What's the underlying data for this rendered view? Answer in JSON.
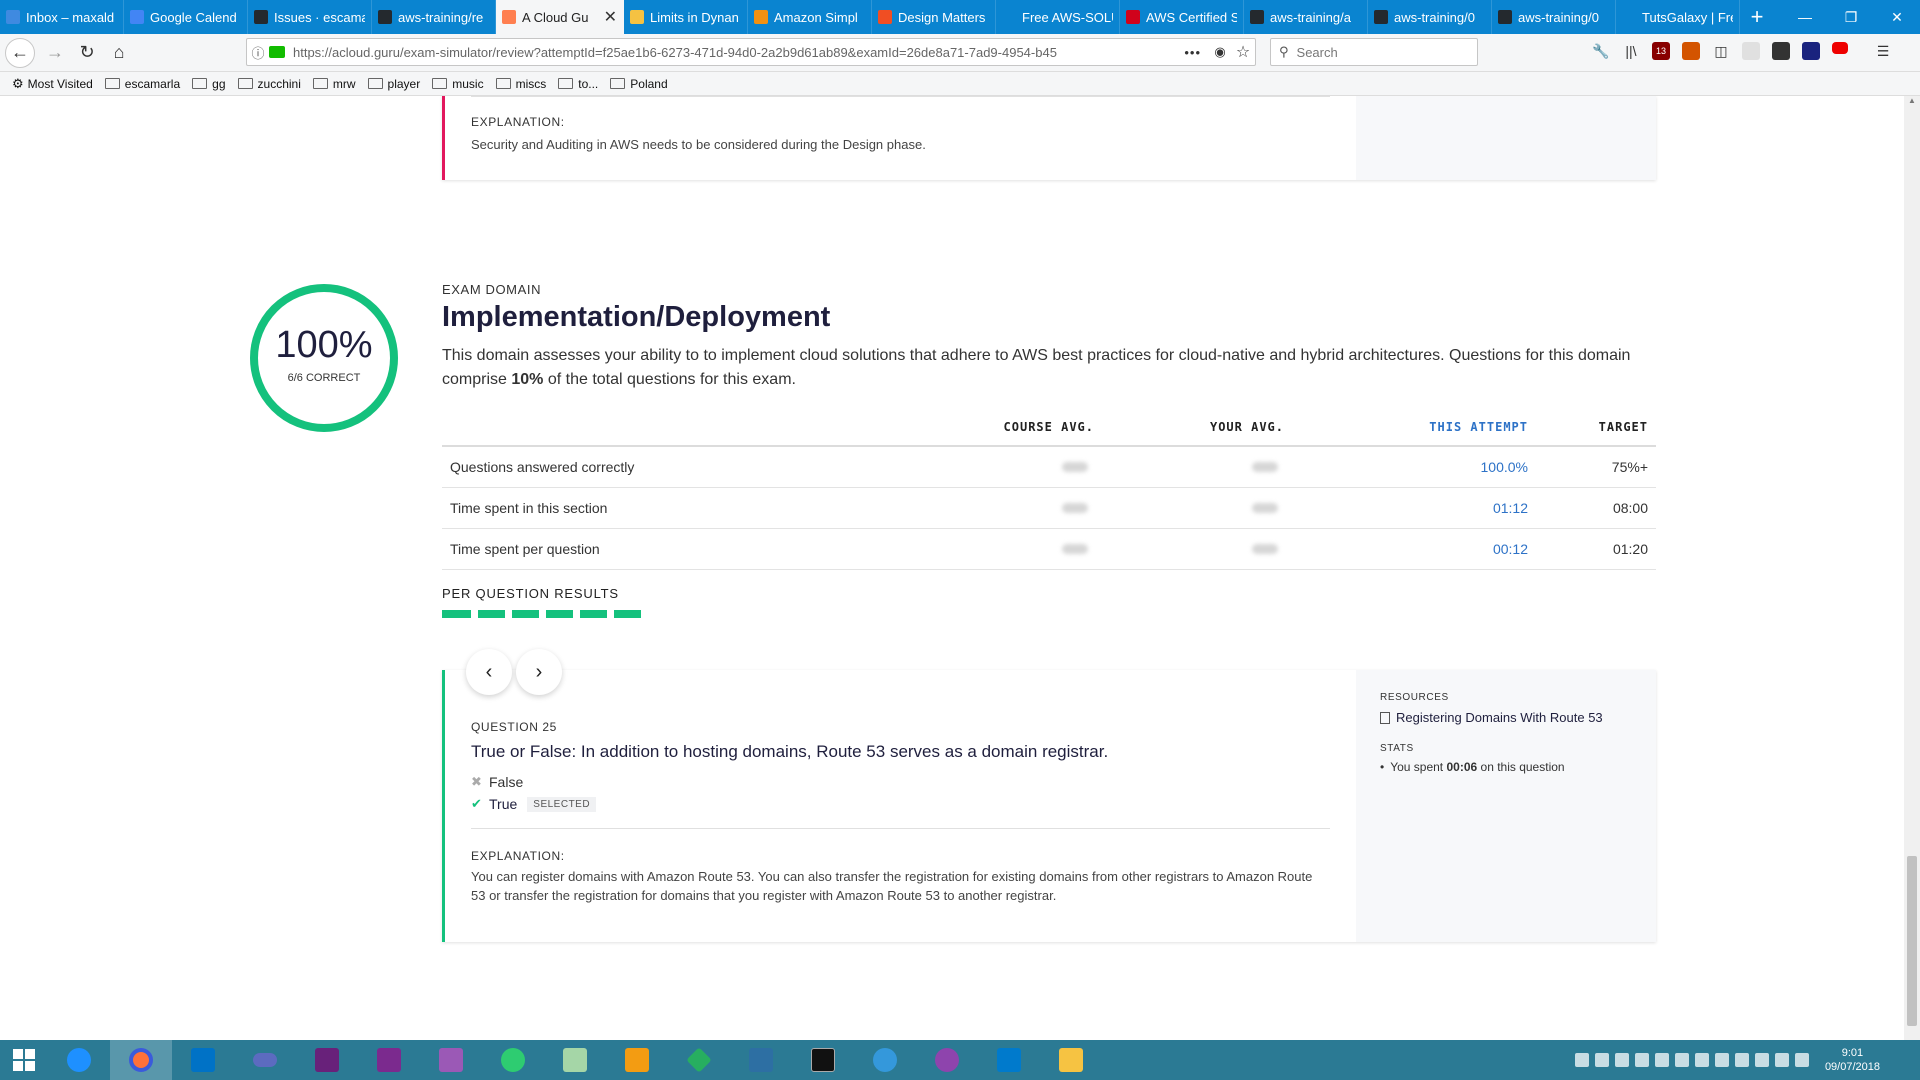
{
  "browser": {
    "tabs": [
      {
        "label": "Inbox – maxald",
        "color": "#3f8ae0"
      },
      {
        "label": "Google Calend",
        "color": "#4285f4"
      },
      {
        "label": "Issues · escama",
        "color": "#24292e"
      },
      {
        "label": "aws-training/re",
        "color": "#24292e"
      },
      {
        "label": "A Cloud Gu",
        "color": "#ff7f50",
        "active": true
      },
      {
        "label": "Limits in Dynan",
        "color": "#f5c242"
      },
      {
        "label": "Amazon Simpl",
        "color": "#f29111"
      },
      {
        "label": "Design Matters",
        "color": "#f04e23"
      },
      {
        "label": "Free AWS-SOLUTIO",
        "color": "#0a84d0"
      },
      {
        "label": "AWS Certified S",
        "color": "#d0021b"
      },
      {
        "label": "aws-training/a",
        "color": "#24292e"
      },
      {
        "label": "aws-training/0",
        "color": "#24292e"
      },
      {
        "label": "aws-training/0",
        "color": "#24292e"
      },
      {
        "label": "TutsGalaxy | Free C",
        "color": "#0a84d0"
      }
    ],
    "url": "https://acloud.guru/exam-simulator/review?attemptId=f25ae1b6-6273-471d-94d0-2a2b9d61ab89&examId=26de8a71-7ad9-4954-b45",
    "url_host": "acloud.guru",
    "search_placeholder": "Search",
    "bookmarks": [
      {
        "label": "Most Visited",
        "type": "gear"
      },
      {
        "label": "escamarla",
        "type": "folder"
      },
      {
        "label": "gg",
        "type": "folder"
      },
      {
        "label": "zucchini",
        "type": "folder"
      },
      {
        "label": "mrw",
        "type": "folder"
      },
      {
        "label": "player",
        "type": "folder"
      },
      {
        "label": "music",
        "type": "folder"
      },
      {
        "label": "miscs",
        "type": "folder"
      },
      {
        "label": "to...",
        "type": "folder"
      },
      {
        "label": "Poland",
        "type": "folder"
      }
    ],
    "notification_badge": "13"
  },
  "prev_card": {
    "explanation_label": "EXPLANATION:",
    "explanation_text": "Security and Auditing in AWS needs to be considered during the Design phase.",
    "accent": "#e2175d"
  },
  "domain": {
    "eyebrow": "EXAM DOMAIN",
    "title": "Implementation/Deployment",
    "desc_before": "This domain assesses your ability to to implement cloud solutions that adhere to AWS best practices for cloud-native and hybrid architectures. Questions for this domain comprise ",
    "desc_bold": "10%",
    "desc_after": " of the total questions for this exam.",
    "score_pct": "100%",
    "score_fraction": 1.0,
    "score_sub": "6/6 CORRECT",
    "ring_color": "#14c17d"
  },
  "stats": {
    "headers": [
      "",
      "COURSE AVG.",
      "YOUR AVG.",
      "THIS ATTEMPT",
      "TARGET"
    ],
    "rows": [
      {
        "label": "Questions answered correctly",
        "attempt": "100.0%",
        "target": "75%+"
      },
      {
        "label": "Time spent in this section",
        "attempt": "01:12",
        "target": "08:00"
      },
      {
        "label": "Time spent per question",
        "attempt": "00:12",
        "target": "01:20"
      }
    ]
  },
  "per_question": {
    "title": "PER QUESTION RESULTS",
    "results": [
      "correct",
      "correct",
      "correct",
      "correct",
      "correct",
      "correct"
    ]
  },
  "question": {
    "number_label": "QUESTION 25",
    "text": "True or False: In addition to hosting domains, Route 53 serves as a domain registrar.",
    "answers": [
      {
        "label": "False",
        "state": "wrong"
      },
      {
        "label": "True",
        "state": "correct",
        "selected_tag": "SELECTED"
      }
    ],
    "explanation_label": "EXPLANATION:",
    "explanation_text": "You can register domains with Amazon Route 53. You can also transfer the registration for existing domains from other registrars to Amazon Route 53 or transfer the registration for domains that you register with Amazon Route 53 to another registrar.",
    "resources_label": "RESOURCES",
    "resource_link": "Registering Domains With Route 53",
    "stats_label": "STATS",
    "stat_before": "You spent ",
    "stat_bold": "00:06",
    "stat_after": " on this question"
  },
  "taskbar": {
    "time": "9:01",
    "date": "09/07/2018"
  }
}
